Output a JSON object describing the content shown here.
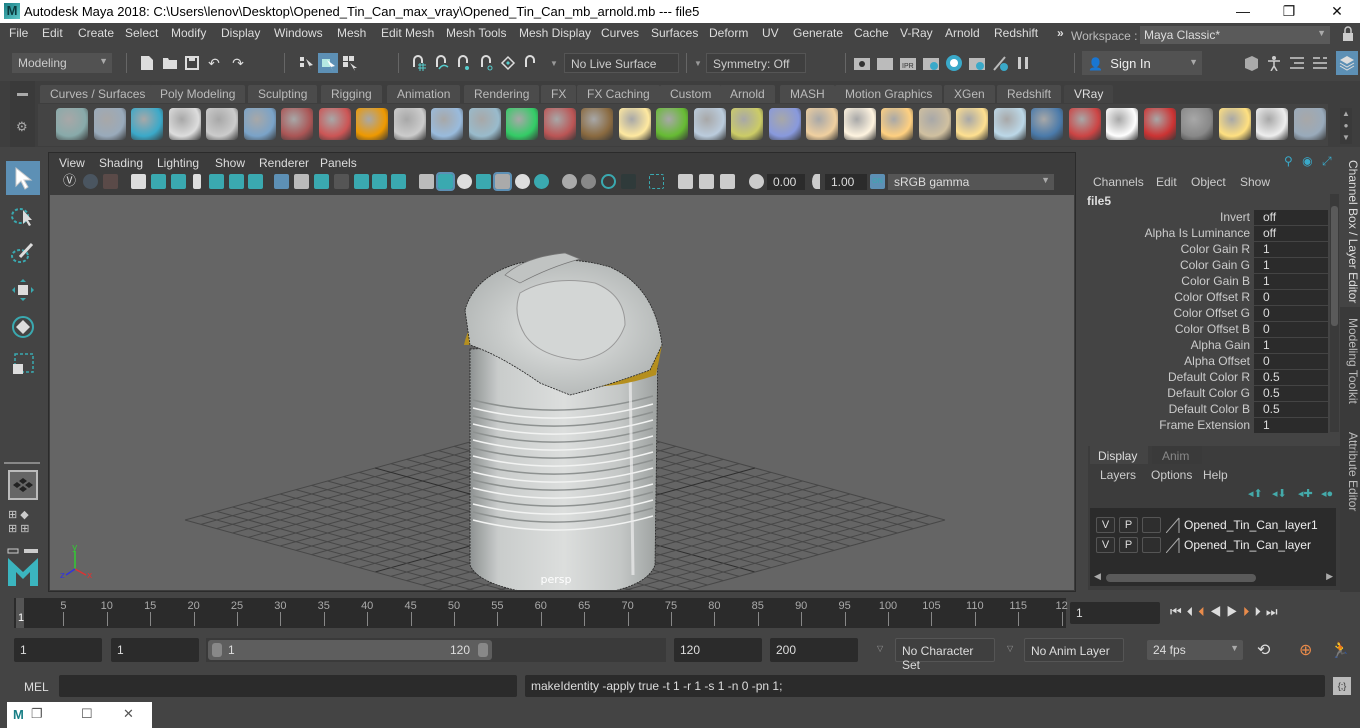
{
  "window": {
    "title": "Autodesk Maya 2018: C:\\Users\\lenov\\Desktop\\Opened_Tin_Can_max_vray\\Opened_Tin_Can_mb_arnold.mb  ---  file5",
    "logo": "M",
    "minimize": "—",
    "maximize": "❐",
    "close": "✕"
  },
  "menubar": {
    "items": [
      "File",
      "Edit",
      "Create",
      "Select",
      "Modify",
      "Display",
      "Windows",
      "Mesh",
      "Edit Mesh",
      "Mesh Tools",
      "Mesh Display",
      "Curves",
      "Surfaces",
      "Deform",
      "UV",
      "Generate",
      "Cache",
      "V-Ray",
      "Arnold",
      "Redshift"
    ],
    "overflow": "»",
    "workspace_label": "Workspace :",
    "workspace_value": "Maya Classic*"
  },
  "statusline": {
    "menuset": "Modeling",
    "live_surface": "No Live Surface",
    "symmetry": "Symmetry: Off",
    "sign_in": "Sign In"
  },
  "shelf": {
    "tabs": [
      "Curves / Surfaces",
      "Poly Modeling",
      "Sculpting",
      "Rigging",
      "Animation",
      "Rendering",
      "FX",
      "FX Caching",
      "Custom",
      "Arnold",
      "MASH",
      "Motion Graphics",
      "XGen",
      "Redshift",
      "VRay"
    ],
    "active_tab": "VRay",
    "icons": [
      "vray-export-icon",
      "vray-import-icon",
      "vray-render-elements-icon",
      "vray-logo-icon",
      "vray-settings-icon",
      "vray-material-icon",
      "vray-camera-icon",
      "vray-blend-material-icon",
      "vray-fire-icon",
      "vray-proxy-icon",
      "vray-shader-ball-icon",
      "vray-cone-icon",
      "vray-volume-grid-icon",
      "vray-fur-icon",
      "vray-mesh-light-icon",
      "vray-sphere-light-icon",
      "vray-grass-icon",
      "vray-scatter-icon",
      "vray-curve-icon",
      "vray-dome-icon",
      "vray-hemisphere-light-icon",
      "vray-ies-light-icon",
      "vray-omni-light-icon",
      "vray-spot-light-icon",
      "vray-sun-icon",
      "vray-rect-light-icon",
      "vray-sphere-icon",
      "vray-flag-icon",
      "vray-checker-icon",
      "vray-framebuffer-icon",
      "vray-panel-icon",
      "vray-light-lister-icon",
      "vray-cloud-icon",
      "help-icon"
    ]
  },
  "viewport": {
    "menus": [
      "View",
      "Shading",
      "Lighting",
      "Show",
      "Renderer",
      "Panels"
    ],
    "exposure": "0.00",
    "gamma": "1.00",
    "color_space": "sRGB gamma",
    "camera_label": "persp",
    "axes": {
      "x": "x",
      "y": "y",
      "z": "z"
    }
  },
  "channelbox": {
    "menus": [
      "Channels",
      "Edit",
      "Object",
      "Show"
    ],
    "node_name": "file5",
    "attributes": [
      {
        "label": "Invert",
        "value": "off"
      },
      {
        "label": "Alpha Is Luminance",
        "value": "off"
      },
      {
        "label": "Color Gain R",
        "value": "1"
      },
      {
        "label": "Color Gain G",
        "value": "1"
      },
      {
        "label": "Color Gain B",
        "value": "1"
      },
      {
        "label": "Color Offset R",
        "value": "0"
      },
      {
        "label": "Color Offset G",
        "value": "0"
      },
      {
        "label": "Color Offset B",
        "value": "0"
      },
      {
        "label": "Alpha Gain",
        "value": "1"
      },
      {
        "label": "Alpha Offset",
        "value": "0"
      },
      {
        "label": "Default Color R",
        "value": "0.5"
      },
      {
        "label": "Default Color G",
        "value": "0.5"
      },
      {
        "label": "Default Color B",
        "value": "0.5"
      },
      {
        "label": "Frame Extension",
        "value": "1"
      }
    ]
  },
  "layer_editor": {
    "tabs": [
      "Display",
      "Anim"
    ],
    "active_tab": "Display",
    "menus": [
      "Layers",
      "Options",
      "Help"
    ],
    "layers": [
      {
        "v": "V",
        "p": "P",
        "name": "Opened_Tin_Can_layer1"
      },
      {
        "v": "V",
        "p": "P",
        "name": "Opened_Tin_Can_layer"
      }
    ]
  },
  "side_tabs": [
    "Channel Box / Layer Editor",
    "Modeling Toolkit",
    "Attribute Editor"
  ],
  "timeline": {
    "ticks": [
      "5",
      "10",
      "15",
      "20",
      "25",
      "30",
      "35",
      "40",
      "45",
      "50",
      "55",
      "60",
      "65",
      "70",
      "75",
      "80",
      "85",
      "90",
      "95",
      "100",
      "105",
      "110",
      "115",
      "12"
    ],
    "current_frame_marker": "1",
    "current_frame": "1"
  },
  "range": {
    "start": "1",
    "anim_start": "1",
    "range_min": "1",
    "range_max": "120",
    "anim_end": "120",
    "end": "200",
    "character_set": "No Character Set",
    "anim_layer": "No Anim Layer",
    "fps": "24 fps"
  },
  "command": {
    "language": "MEL",
    "input": "",
    "result": "makeIdentity -apply true -t 1 -r 1 -s 1 -n 0 -pn 1;"
  }
}
